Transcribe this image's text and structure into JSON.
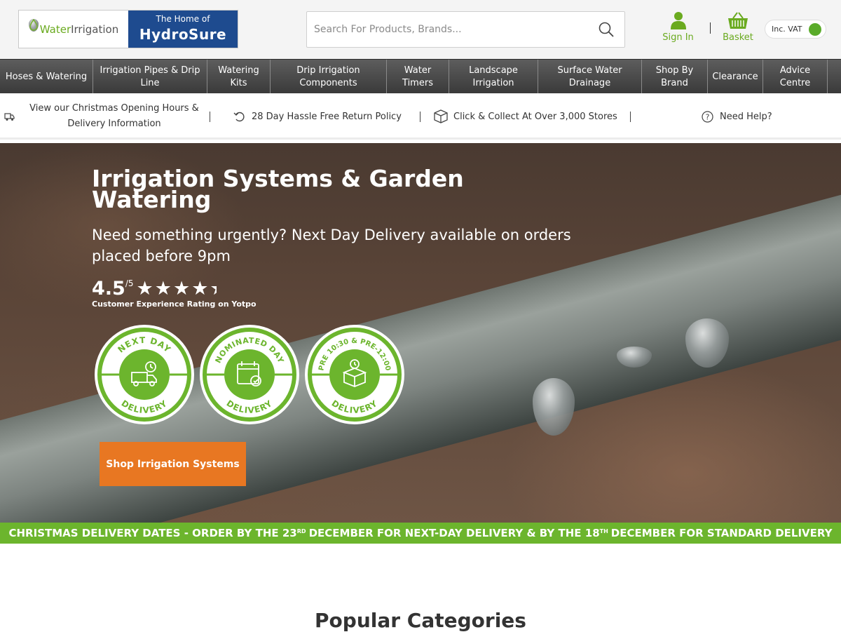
{
  "header": {
    "logo_left": "Irrigation",
    "logo_left_w": "Water",
    "logo_right_small": "The Home of",
    "logo_right_big": "HydroSure",
    "search_placeholder": "Search For Products, Brands...",
    "signin_label": "Sign In",
    "basket_label": "Basket",
    "vat_label": "Inc. VAT"
  },
  "nav": {
    "items": [
      "Hoses & Watering",
      "Irrigation Pipes & Drip Line",
      "Watering Kits",
      "Drip Irrigation Components",
      "Water Timers",
      "Landscape Irrigation",
      "Surface Water Drainage",
      "Shop By Brand",
      "Clearance",
      "Advice Centre"
    ]
  },
  "infobar": {
    "christmas": "View our Christmas Opening Hours & Delivery Information",
    "returns": "28 Day Hassle Free Return Policy",
    "collect": "Click & Collect At Over 3,000 Stores",
    "help": "Need Help?"
  },
  "hero": {
    "title": "Irrigation Systems & Garden Watering",
    "subtitle": "Need something urgently? Next Day Delivery available on orders placed before 9pm",
    "rating": "4.5",
    "rating_of": "/5",
    "rating_stars": "★★★★★",
    "rating_value": 4.5,
    "rating_caption": "Customer Experience Rating on Yotpo",
    "badges": [
      {
        "top": "NEXT DAY",
        "bottom": "DELIVERY"
      },
      {
        "top": "NOMINATED DAY",
        "bottom": "DELIVERY"
      },
      {
        "top": "PRE 10:30 & PRE-12:00",
        "bottom": "DELIVERY"
      }
    ],
    "cta": "Shop Irrigation Systems"
  },
  "banner": {
    "part1": "CHRISTMAS DELIVERY DATES - ORDER BY THE 23",
    "sup1": "RD",
    "part2": "DECEMBER FOR NEXT-DAY DELIVERY & BY THE 18",
    "sup2": "TH",
    "part3": "DECEMBER FOR STANDARD DELIVERY"
  },
  "popular_heading": "Popular Categories",
  "colors": {
    "brand_green": "#6cb52d",
    "brand_blue": "#1e4b8f",
    "cta_orange": "#e87722",
    "nav_dark": "#3a3a3a"
  }
}
